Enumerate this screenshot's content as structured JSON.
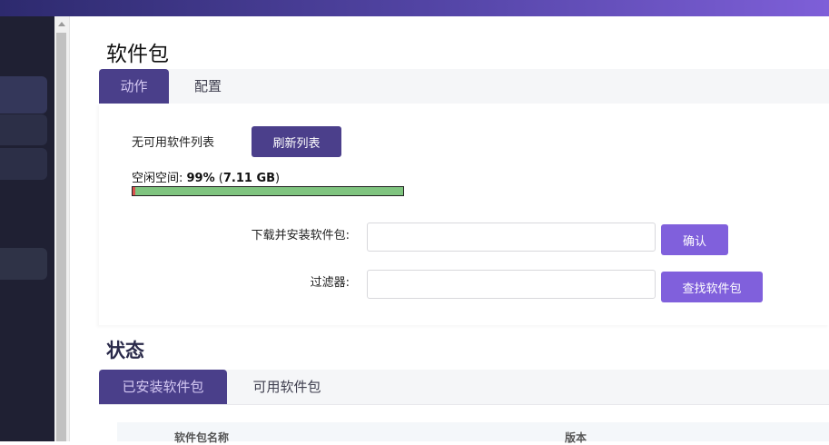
{
  "page": {
    "title": "软件包"
  },
  "actions_tabs": [
    {
      "label": "动作",
      "active": true
    },
    {
      "label": "配置",
      "active": false
    }
  ],
  "actions": {
    "no_list_text": "无可用软件列表",
    "refresh_button": "刷新列表",
    "free_space_label": "空闲空间: ",
    "free_space_percent": "99%",
    "free_space_open": " (",
    "free_space_size": "7.11 GB",
    "free_space_close": ")",
    "free_space_fraction": 0.99,
    "download_label": "下载并安装软件包:",
    "download_value": "",
    "confirm_button": "确认",
    "filter_label": "过滤器:",
    "filter_value": "",
    "find_button": "查找软件包"
  },
  "status": {
    "title": "状态",
    "tabs": [
      {
        "label": "已安装软件包",
        "active": true
      },
      {
        "label": "可用软件包",
        "active": false
      }
    ],
    "columns": [
      "软件包名称",
      "版本"
    ]
  },
  "colors": {
    "accent_dark": "#4b3f8b",
    "accent": "#8060dc",
    "sidebar": "#1f2033",
    "disk_free": "#7fc47f",
    "disk_used": "#d9534f"
  }
}
